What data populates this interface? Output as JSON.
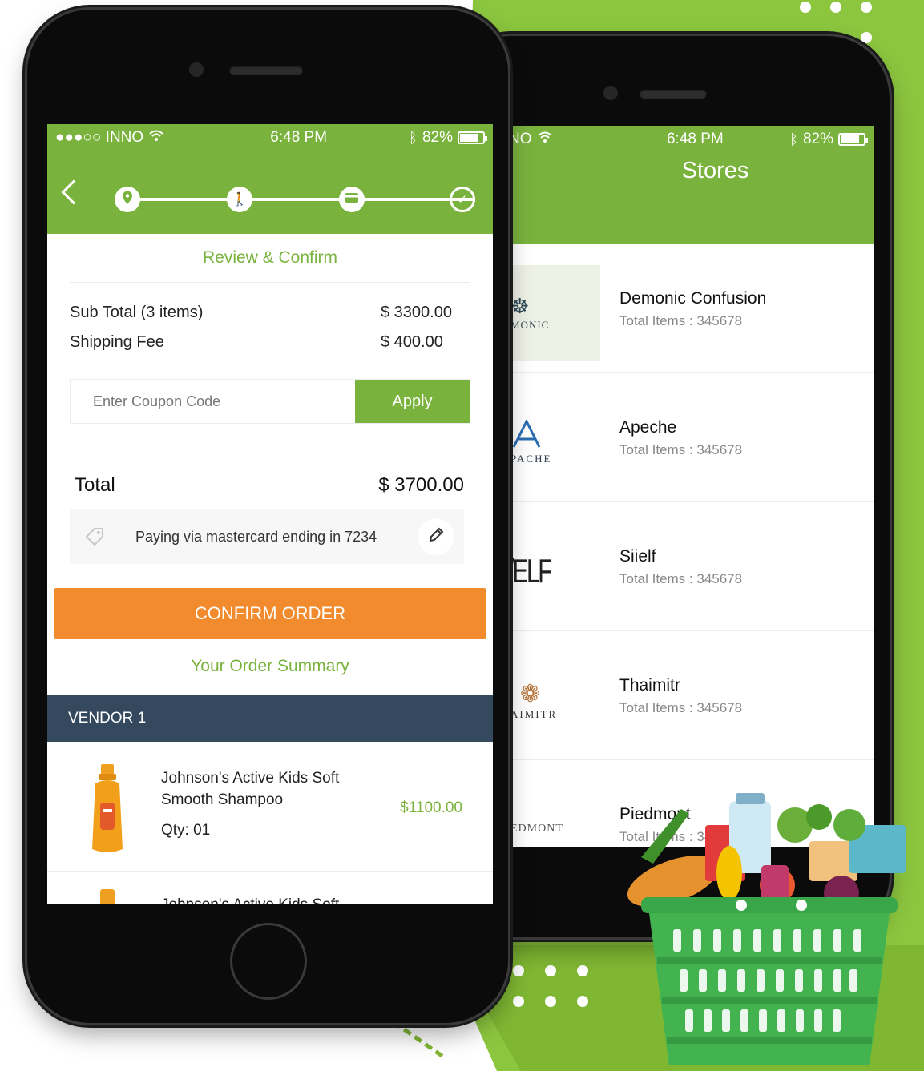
{
  "left_phone": {
    "status": {
      "carrier": "●●●○○ INNO",
      "wifi": "wifi-icon",
      "time": "6:48 PM",
      "bluetooth": "bluetooth-icon",
      "battery_percent": "82%",
      "battery_level": 0.82
    },
    "steps": [
      {
        "icon": "location-pin-icon",
        "state": "current"
      },
      {
        "icon": "person-walk-icon",
        "state": "pending"
      },
      {
        "icon": "credit-card-icon",
        "state": "pending"
      },
      {
        "icon": "check-icon",
        "state": "done"
      }
    ],
    "review_title": "Review & Confirm",
    "summary": {
      "subtotal_label": "Sub Total (3 items)",
      "subtotal_value": "$ 3300.00",
      "shipping_label": "Shipping Fee",
      "shipping_value": "$ 400.00"
    },
    "coupon": {
      "placeholder": "Enter Coupon Code",
      "apply_label": "Apply"
    },
    "total": {
      "label": "Total",
      "value": "$ 3700.00"
    },
    "payment": {
      "text": "Paying via mastercard ending in 7234"
    },
    "confirm_label": "CONFIRM ORDER",
    "order_summary_title": "Your Order Summary",
    "vendor_label": "VENDOR 1",
    "products": [
      {
        "name": "Johnson's Active Kids Soft Smooth Shampoo",
        "qty": "Qty: 01",
        "price": "$1100.00"
      },
      {
        "name": "Johnson's Active Kids Soft"
      }
    ]
  },
  "right_phone": {
    "status": {
      "carrier": "NO",
      "wifi": "wifi-icon",
      "time": "6:48 PM",
      "bluetooth": "bluetooth-icon",
      "battery_percent": "82%",
      "battery_level": 0.82
    },
    "title": "Stores",
    "stores": [
      {
        "name": "Demonic Confusion",
        "count": "Total Items : 345678",
        "logo_text": "MONIC"
      },
      {
        "name": "Apeche",
        "count": "Total Items : 345678",
        "logo_text": "PACHE"
      },
      {
        "name": "Siielf",
        "count": "Total Items : 345678",
        "logo_text": "/ELF"
      },
      {
        "name": "Thaimitr",
        "count": "Total Items : 345678",
        "logo_text": "AIMITR"
      },
      {
        "name": "Piedmont",
        "count": "Total Items : 345678",
        "logo_text": "EDMONT"
      }
    ]
  },
  "colors": {
    "green": "#7ab23e",
    "orange": "#f18b2e",
    "vendor_bar": "#34495e",
    "bg_green": "#8cc63f"
  }
}
